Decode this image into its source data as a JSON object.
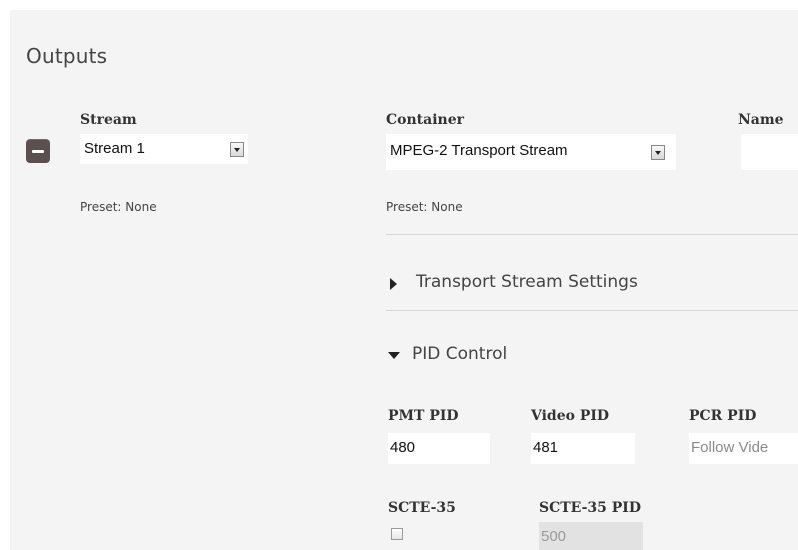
{
  "outputs": {
    "title": "Outputs"
  },
  "stream": {
    "label": "Stream",
    "selected": "Stream 1",
    "preset": "Preset: None"
  },
  "container": {
    "label": "Container",
    "selected": "MPEG-2 Transport Stream",
    "preset": "Preset: None"
  },
  "name": {
    "label": "Name",
    "value": ""
  },
  "sections": {
    "transport_stream_settings": "Transport Stream Settings",
    "pid_control": "PID Control"
  },
  "pid": {
    "pmt_label": "PMT PID",
    "pmt_value": "480",
    "video_label": "Video PID",
    "video_value": "481",
    "pcr_label": "PCR PID",
    "pcr_value": "Follow Vide",
    "scte35_label": "SCTE-35",
    "scte35_checked": false,
    "scte35_pid_label": "SCTE-35 PID",
    "scte35_pid_value": "500"
  },
  "colors": {
    "panel_bg": "#f4f4f4",
    "remove_button": "#5b4f4f"
  },
  "icons": {
    "remove": "minus-icon",
    "dropdown": "chevron-down-icon",
    "collapsed": "triangle-right-icon",
    "expanded": "triangle-down-icon"
  }
}
